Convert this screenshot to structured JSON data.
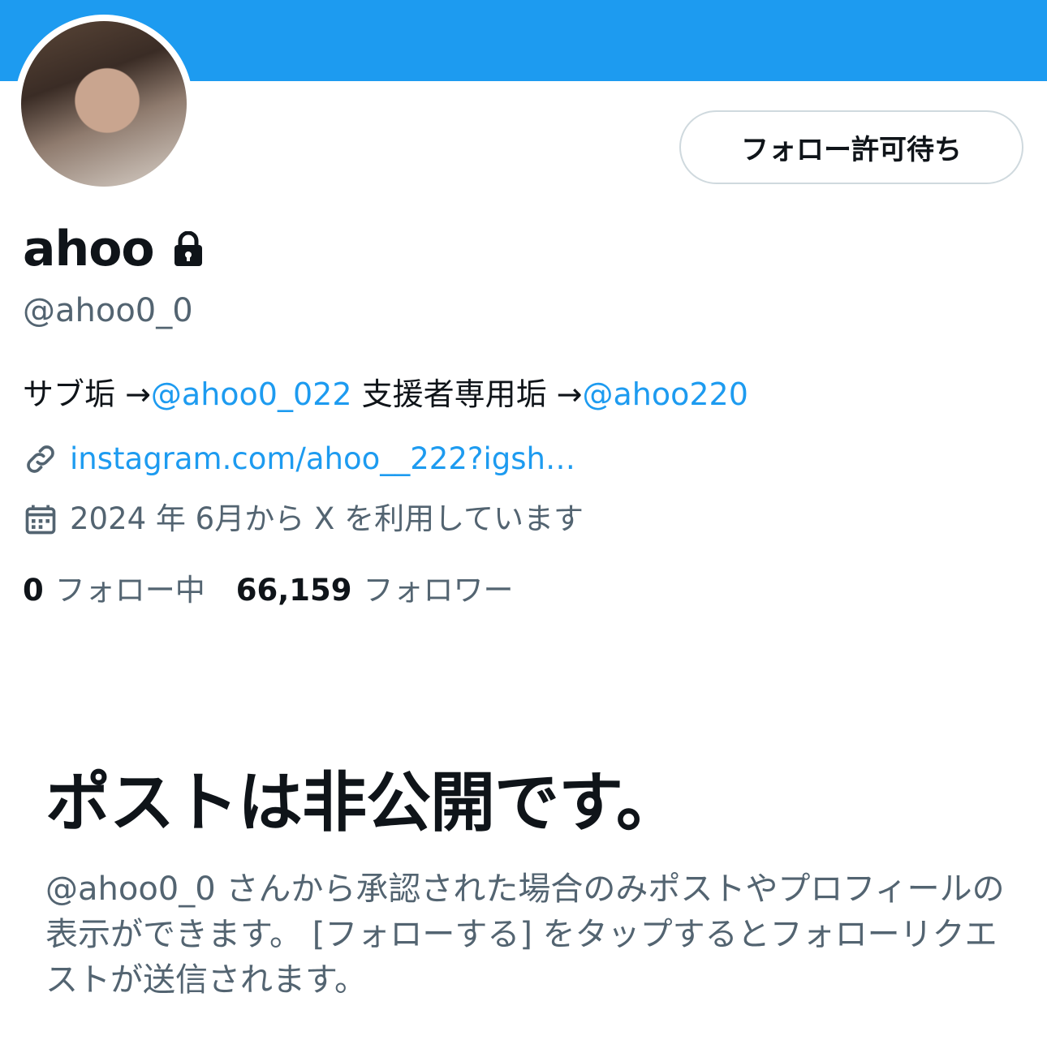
{
  "profile": {
    "display_name": "ahoo",
    "handle": "@ahoo0_0",
    "follow_button_label": "フォロー許可待ち",
    "bio": {
      "part1": "サブ垢 →",
      "mention1": "@ahoo0_022",
      "part2": " 支援者専用垢 →",
      "mention2": "@ahoo220"
    },
    "url": "instagram.com/ahoo__222?igsh…",
    "joined": "2024 年 6月から X を利用しています",
    "following_count": "0",
    "following_label": "フォロー中",
    "followers_count": "66,159",
    "followers_label": "フォロワー"
  },
  "private_notice": {
    "title": "ポストは非公開です。",
    "description": "@ahoo0_0 さんから承認された場合のみポストやプロフィールの表示ができます。 [フォローする] をタップするとフォローリクエストが送信されます。"
  },
  "icons": {
    "lock": "lock-icon",
    "link": "link-icon",
    "calendar": "calendar-icon"
  },
  "colors": {
    "banner": "#1d9bf0",
    "link": "#1d9bf0",
    "secondary_text": "#536471",
    "primary_text": "#0f1419",
    "button_border": "#cfd9de"
  }
}
